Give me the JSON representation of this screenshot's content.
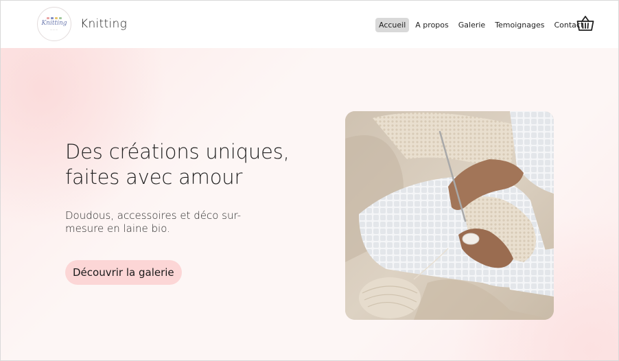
{
  "header": {
    "brand": "Knitting",
    "logo_text": "Knitting",
    "nav": [
      {
        "label": "Accueil",
        "active": true
      },
      {
        "label": "A propos",
        "active": false
      },
      {
        "label": "Galerie",
        "active": false
      },
      {
        "label": "Temoignages",
        "active": false
      },
      {
        "label": "Contact",
        "active": false
      }
    ],
    "cart_icon": "basket-icon"
  },
  "hero": {
    "headline": "Des créations uniques, faites avec amour",
    "subtitle": "Doudous, accessoires et déco sur-mesure en laine bio.",
    "cta_label": "Découvrir la galerie",
    "image_subject": "hands-crocheting-photo"
  },
  "colors": {
    "accent_pink": "#fcd6d6",
    "nav_active_bg": "#d9d9d9",
    "text": "#1f1f1f"
  }
}
